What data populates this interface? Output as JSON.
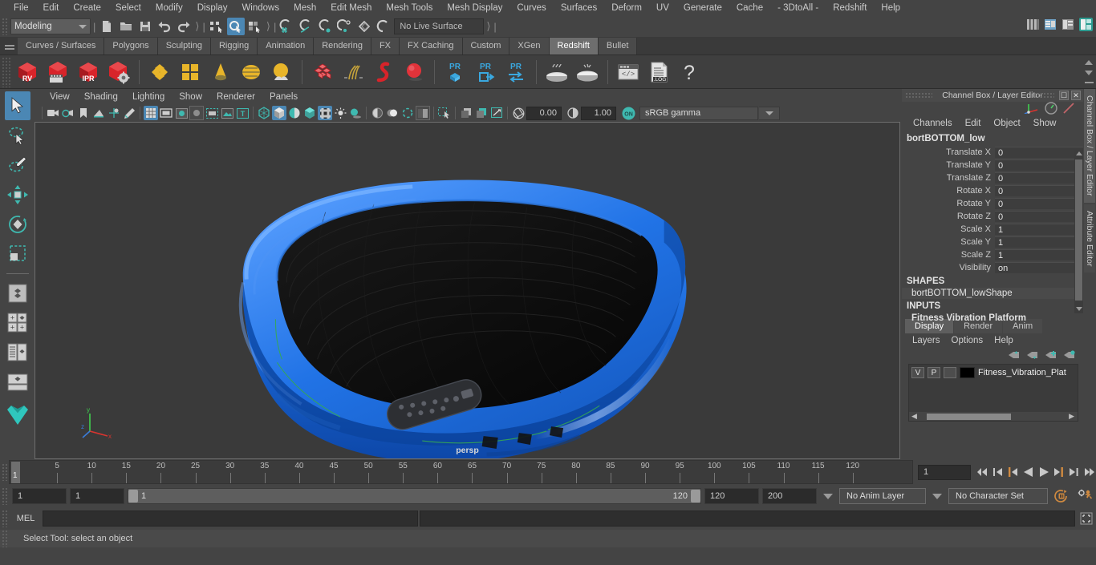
{
  "menubar": {
    "items": [
      "File",
      "Edit",
      "Create",
      "Select",
      "Modify",
      "Display",
      "Windows",
      "Mesh",
      "Edit Mesh",
      "Mesh Tools",
      "Mesh Display",
      "Curves",
      "Surfaces",
      "Deform",
      "UV",
      "Generate",
      "Cache",
      "- 3DtoAll -",
      "Redshift",
      "Help"
    ]
  },
  "statusline": {
    "menuset": "Modeling",
    "live_surface": "No Live Surface"
  },
  "shelf": {
    "tabs": [
      "Curves / Surfaces",
      "Polygons",
      "Sculpting",
      "Rigging",
      "Animation",
      "Rendering",
      "FX",
      "FX Caching",
      "Custom",
      "XGen",
      "Redshift",
      "Bullet"
    ],
    "active_tab": "Redshift",
    "icons": [
      "redshift-rv-icon",
      "redshift-sequence-icon",
      "redshift-ipr-icon",
      "redshift-settings-icon",
      "redshift-proxy-icon",
      "redshift-matte-icon",
      "redshift-light-dome-icon",
      "redshift-sky-icon",
      "redshift-env-icon",
      "redshift-volume-icon",
      "redshift-hair-icon",
      "redshift-curve-icon",
      "redshift-sphere-icon",
      "redshift-pr-cube-icon",
      "redshift-pr-export-icon",
      "redshift-pr-transfer-icon",
      "redshift-bake-icon",
      "redshift-bake2-icon",
      "redshift-script-icon",
      "redshift-log-icon",
      "redshift-help-icon"
    ]
  },
  "viewport": {
    "menus": [
      "View",
      "Shading",
      "Lighting",
      "Show",
      "Renderer",
      "Panels"
    ],
    "exposure": "0.00",
    "gamma": "1.00",
    "color_mode": "sRGB gamma",
    "camera_label": "persp",
    "axis": {
      "x": "x",
      "y": "y",
      "z": "z"
    }
  },
  "channelbox": {
    "title": "Channel Box / Layer Editor",
    "menus": [
      "Channels",
      "Edit",
      "Object",
      "Show"
    ],
    "node_name": "bortBOTTOM_low",
    "attributes": [
      {
        "label": "Translate X",
        "value": "0"
      },
      {
        "label": "Translate Y",
        "value": "0"
      },
      {
        "label": "Translate Z",
        "value": "0"
      },
      {
        "label": "Rotate X",
        "value": "0"
      },
      {
        "label": "Rotate Y",
        "value": "0"
      },
      {
        "label": "Rotate Z",
        "value": "0"
      },
      {
        "label": "Scale X",
        "value": "1"
      },
      {
        "label": "Scale Y",
        "value": "1"
      },
      {
        "label": "Scale Z",
        "value": "1"
      },
      {
        "label": "Visibility",
        "value": "on"
      }
    ],
    "shapes_header": "SHAPES",
    "shape_name": "bortBOTTOM_lowShape",
    "inputs_header": "INPUTS",
    "input_name": "Fitness Vibration Platform"
  },
  "layereditor": {
    "tabs": [
      "Display",
      "Render",
      "Anim"
    ],
    "active_tab": "Display",
    "menus": [
      "Layers",
      "Options",
      "Help"
    ],
    "layers": [
      {
        "visibility": "V",
        "playback": "P",
        "shading": "",
        "color": "#000000",
        "name": "Fitness_Vibration_Plat"
      }
    ]
  },
  "right_vtabs": [
    {
      "label": "Channel Box / Layer Editor",
      "selected": true
    },
    {
      "label": "Attribute Editor",
      "selected": false
    }
  ],
  "timeline": {
    "ticks": [
      5,
      10,
      15,
      20,
      25,
      30,
      35,
      40,
      45,
      50,
      55,
      60,
      65,
      70,
      75,
      80,
      85,
      90,
      95,
      100,
      105,
      110,
      115,
      120
    ],
    "current_frame": "1",
    "frame_field": "1",
    "playback_buttons": [
      "go-to-start-icon",
      "step-back-keyframe-icon",
      "step-back-frame-icon",
      "play-backwards-icon",
      "play-forwards-icon",
      "step-forward-frame-icon",
      "step-forward-keyframe-icon",
      "go-to-end-icon"
    ]
  },
  "rangeslider": {
    "anim_start": "1",
    "range_start": "1",
    "bar_start": "1",
    "bar_end": "120",
    "range_end": "120",
    "anim_end": "200",
    "anim_layer": "No Anim Layer",
    "character_set": "No Character Set"
  },
  "commandline": {
    "label": "MEL",
    "input_value": "",
    "output_value": ""
  },
  "statusbar": {
    "message": "Select Tool: select an object"
  },
  "colors": {
    "accent_blue": "#4b87b4",
    "panel_bg": "#444444",
    "viewport_bg": "#3a3a3a",
    "model_blue": "#1f6fe0",
    "model_dark": "#111111",
    "redshift_red": "#d8242a",
    "shelf_gold": "#e8b52a",
    "orange": "#d08a40"
  }
}
